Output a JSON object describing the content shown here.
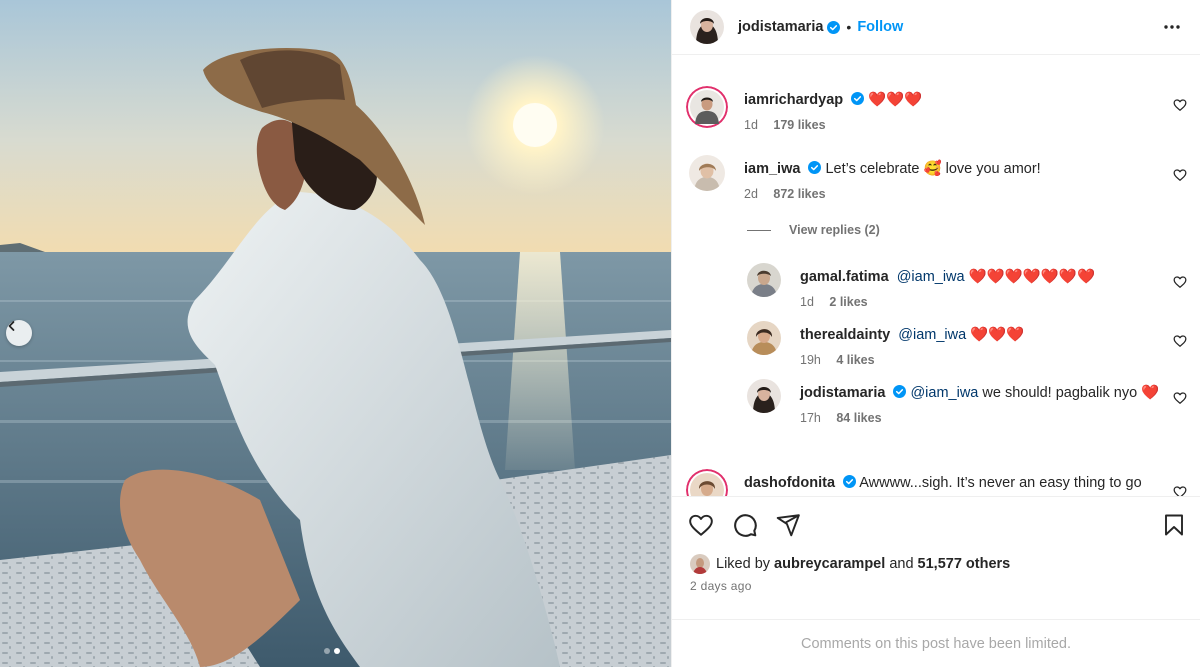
{
  "post": {
    "owner": "jodistamaria",
    "follow_label": "Follow",
    "bullet": "•",
    "carousel": {
      "current_slide": 2,
      "total_slides": 2
    }
  },
  "comments": [
    {
      "user": "iamrichardyap",
      "verified": true,
      "mention": "",
      "text": "❤️❤️❤️",
      "time": "1d",
      "likes": "179 likes"
    },
    {
      "user": "iam_iwa",
      "verified": true,
      "mention": "",
      "text": "Let’s celebrate 🥰 love you amor!",
      "time": "2d",
      "likes": "872 likes"
    },
    {
      "user": "dashofdonita",
      "verified": true,
      "mention": "",
      "text": "Awwww...sigh. It’s never an easy thing to go"
    }
  ],
  "view_replies_label": "View replies (2)",
  "replies": [
    {
      "user": "gamal.fatima",
      "mention": "@iam_iwa",
      "text": "❤️❤️❤️❤️❤️❤️❤️",
      "time": "1d",
      "likes": "2 likes"
    },
    {
      "user": "therealdainty",
      "mention": "@iam_iwa",
      "text": "❤️❤️❤️",
      "time": "19h",
      "likes": "4 likes"
    },
    {
      "user": "jodistamaria",
      "verified": true,
      "mention": "@iam_iwa",
      "text": "we should! pagbalik nyo ❤️",
      "time": "17h",
      "likes": "84 likes"
    }
  ],
  "liked_by": {
    "prefix": "Liked by",
    "user": "aubreycarampel",
    "and": "and",
    "others": "51,577 others"
  },
  "posted_ago": "2 days ago",
  "comments_limited": "Comments on this post have been limited.",
  "colors": {
    "accent": "#0095f6",
    "verified": "#0095f6",
    "mention": "#00376b",
    "muted": "#737373"
  },
  "icons": [
    "chevron-left-icon",
    "more-horizontal-icon",
    "verified-icon",
    "heart-icon",
    "comment-icon",
    "share-icon",
    "bookmark-icon"
  ]
}
